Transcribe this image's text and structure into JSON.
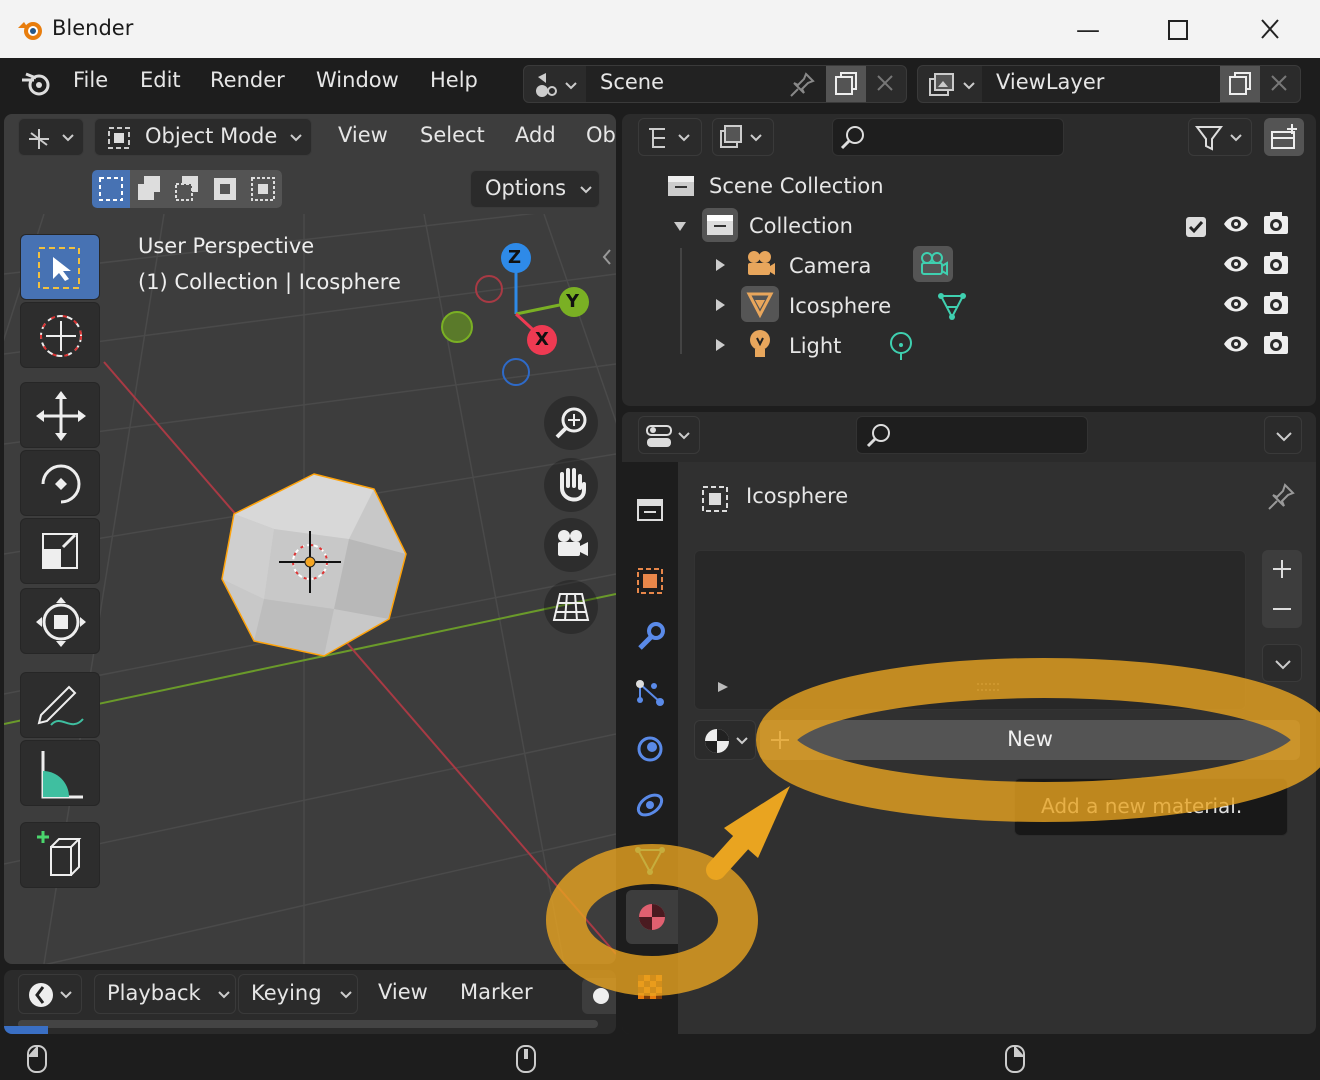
{
  "window": {
    "title": "Blender"
  },
  "menubar": {
    "items": [
      "File",
      "Edit",
      "Render",
      "Window",
      "Help"
    ],
    "scene": "Scene",
    "view_layer": "ViewLayer"
  },
  "viewport": {
    "mode": "Object Mode",
    "menus": [
      "View",
      "Select",
      "Add",
      "Ob"
    ],
    "options": "Options",
    "overlay_line1": "User Perspective",
    "overlay_line2": "(1) Collection | Icosphere",
    "gizmo": {
      "z": "Z",
      "y": "Y",
      "x": "X"
    }
  },
  "outliner": {
    "scene_collection": "Scene Collection",
    "collection": "Collection",
    "items": [
      "Camera",
      "Icosphere",
      "Light"
    ]
  },
  "properties": {
    "object_name": "Icosphere",
    "new_button": "New",
    "tooltip": "Add a new material."
  },
  "timeline": {
    "menus": [
      "Playback",
      "Keying",
      "View",
      "Marker"
    ]
  },
  "colors": {
    "accent": "#e9a420",
    "selection": "#4772b3",
    "axis_x": "#ee3a52",
    "axis_y": "#7ab024",
    "axis_z": "#2e8ae8"
  }
}
